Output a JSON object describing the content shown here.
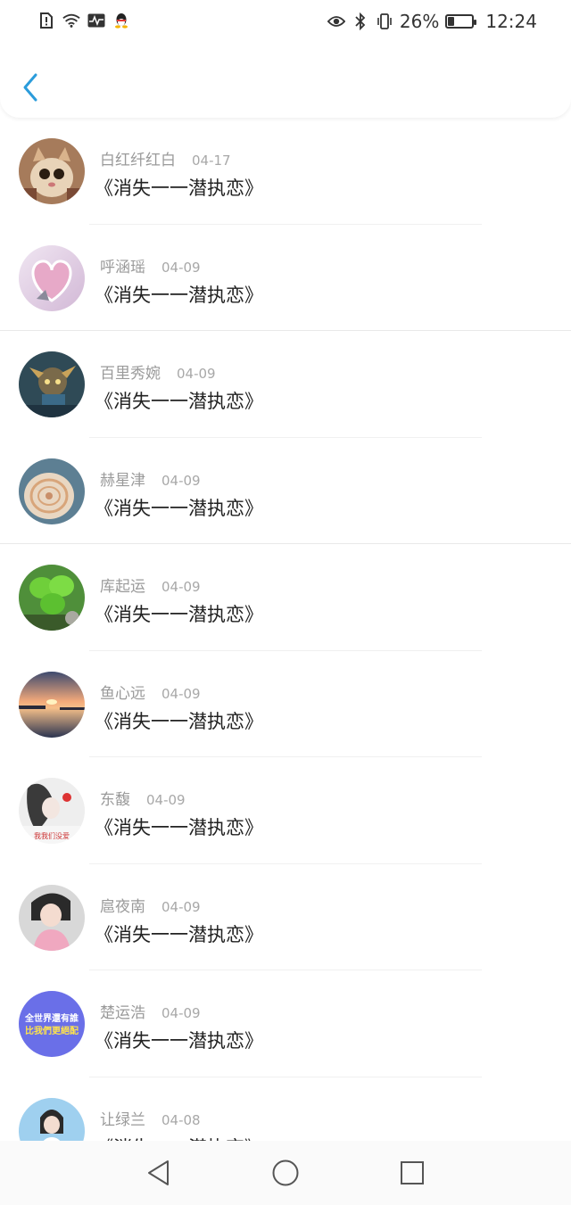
{
  "status": {
    "battery_percent": "26%",
    "battery_level": 0.26,
    "time": "12:24",
    "left_icons": [
      "sim-alert-icon",
      "wifi-icon",
      "activity-icon",
      "qq-icon"
    ],
    "right_icons": [
      "eye-icon",
      "bluetooth-icon",
      "vibrate-icon"
    ]
  },
  "header": {
    "back_icon": "chevron-left-icon",
    "accent": "#2b9cdb"
  },
  "items": [
    {
      "name": "白红纤红白",
      "date": "04-17",
      "title": "《消失一一潜执恋》"
    },
    {
      "name": "呼涵瑶",
      "date": "04-09",
      "title": "《消失一一潜执恋》"
    },
    {
      "name": "百里秀婉",
      "date": "04-09",
      "title": "《消失一一潜执恋》"
    },
    {
      "name": "赫星津",
      "date": "04-09",
      "title": "《消失一一潜执恋》"
    },
    {
      "name": "库起运",
      "date": "04-09",
      "title": "《消失一一潜执恋》"
    },
    {
      "name": "鱼心远",
      "date": "04-09",
      "title": "《消失一一潜执恋》"
    },
    {
      "name": "东馥",
      "date": "04-09",
      "title": "《消失一一潜执恋》"
    },
    {
      "name": "扈夜南",
      "date": "04-09",
      "title": "《消失一一潜执恋》"
    },
    {
      "name": "楚运浩",
      "date": "04-09",
      "title": "《消失一一潜执恋》"
    },
    {
      "name": "让绿兰",
      "date": "04-08",
      "title": "《消失一一潜执恋》"
    }
  ],
  "avatar_texts": {
    "avatar7": "我我们没爱",
    "avatar9_line1": "全世界還有誰",
    "avatar9_line2": "比我們更絕配"
  },
  "nav": {
    "icons": [
      "back-triangle-icon",
      "home-circle-icon",
      "recents-square-icon"
    ]
  }
}
